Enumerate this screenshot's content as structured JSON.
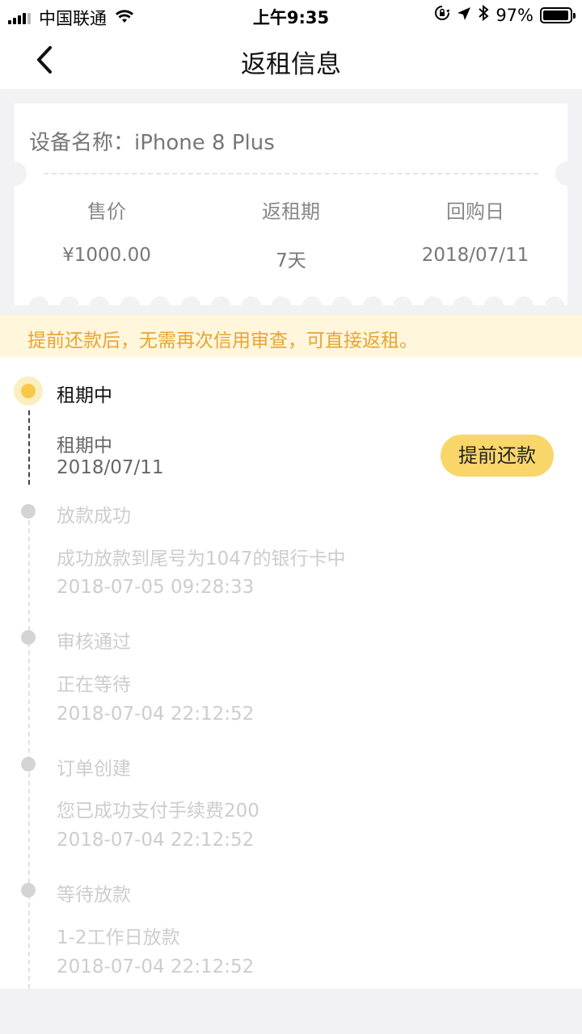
{
  "status_bar": {
    "carrier": "中国联通",
    "time": "上午9:35",
    "battery_percent": "97%",
    "battery_level": 0.97,
    "icons": [
      "signal-icon",
      "wifi-icon",
      "orientation-lock-icon",
      "location-arrow-icon",
      "bluetooth-icon",
      "battery-icon"
    ]
  },
  "nav": {
    "title": "返租信息",
    "back_icon": "chevron-left-icon"
  },
  "card": {
    "device_name": "设备名称：iPhone 8 Plus",
    "columns": [
      {
        "label": "售价",
        "value": "¥1000.00"
      },
      {
        "label": "返租期",
        "value": "7天"
      },
      {
        "label": "回购日",
        "value": "2018/07/11"
      }
    ]
  },
  "notice": "提前还款后，无需再次信用审查，可直接返租。",
  "timeline": {
    "active": {
      "title": "租期中",
      "status": "租期中",
      "date": "2018/07/11",
      "button": "提前还款"
    },
    "steps": [
      {
        "title": "放款成功",
        "desc": "成功放款到尾号为1047的银行卡中",
        "time": "2018-07-05 09:28:33"
      },
      {
        "title": "审核通过",
        "desc": "正在等待",
        "time": "2018-07-04 22:12:52"
      },
      {
        "title": "订单创建",
        "desc": "您已成功支付手续费200",
        "time": "2018-07-04 22:12:52"
      },
      {
        "title": "等待放款",
        "desc": "1-2工作日放款",
        "time": "2018-07-04 22:12:52"
      }
    ]
  },
  "colors": {
    "accent": "#f7c94a",
    "button_bg": "#f8d66a",
    "notice_bg": "#fff6dc",
    "notice_text": "#e6a532",
    "page_bg": "#f2f2f4"
  }
}
